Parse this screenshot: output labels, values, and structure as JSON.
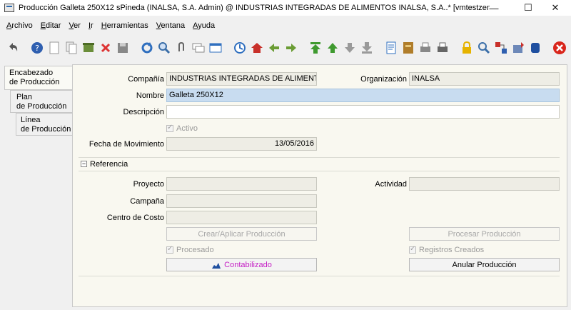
{
  "window": {
    "title": "Producción  Galleta 250X12  sPineda (INALSA, S.A. Admin) @ INDUSTRIAS INTEGRADAS DE ALIMENTOS INALSA, S.A..* [vmtestzenith{vmtestze...",
    "minimize": "—",
    "maximize": "☐",
    "close": "✕"
  },
  "menu": [
    "Archivo",
    "Editar",
    "Ver",
    "Ir",
    "Herramientas",
    "Ventana",
    "Ayuda"
  ],
  "tabs": [
    {
      "line1": "Encabezado",
      "line2": "de Producción"
    },
    {
      "line1": "Plan",
      "line2": "de Producción"
    },
    {
      "line1": "Línea",
      "line2": "de Producción"
    }
  ],
  "form": {
    "compania_label": "Compañía",
    "compania_value": "INDUSTRIAS INTEGRADAS DE ALIMENTOS",
    "organizacion_label": "Organización",
    "organizacion_value": "INALSA",
    "nombre_label": "Nombre",
    "nombre_value": "Galleta 250X12",
    "descripcion_label": "Descripción",
    "descripcion_value": "",
    "activo_label": "Activo",
    "fecha_label": "Fecha de Movimiento",
    "fecha_value": "13/05/2016"
  },
  "referencia": {
    "section_label": "Referencia",
    "toggle": "−",
    "proyecto_label": "Proyecto",
    "actividad_label": "Actividad",
    "campana_label": "Campaña",
    "centro_label": "Centro de Costo"
  },
  "actions": {
    "crear_aplicar": "Crear/Aplicar Producción",
    "procesar": "Procesar Producción",
    "procesado_label": "Procesado",
    "registros_label": "Registros Creados",
    "contabilizado": "Contabilizado",
    "anular": "Anular Producción"
  },
  "colors": {
    "accent_blue": "#c8dcf0",
    "contabilizado_text": "#c520c5",
    "close_red": "#d9261c"
  }
}
